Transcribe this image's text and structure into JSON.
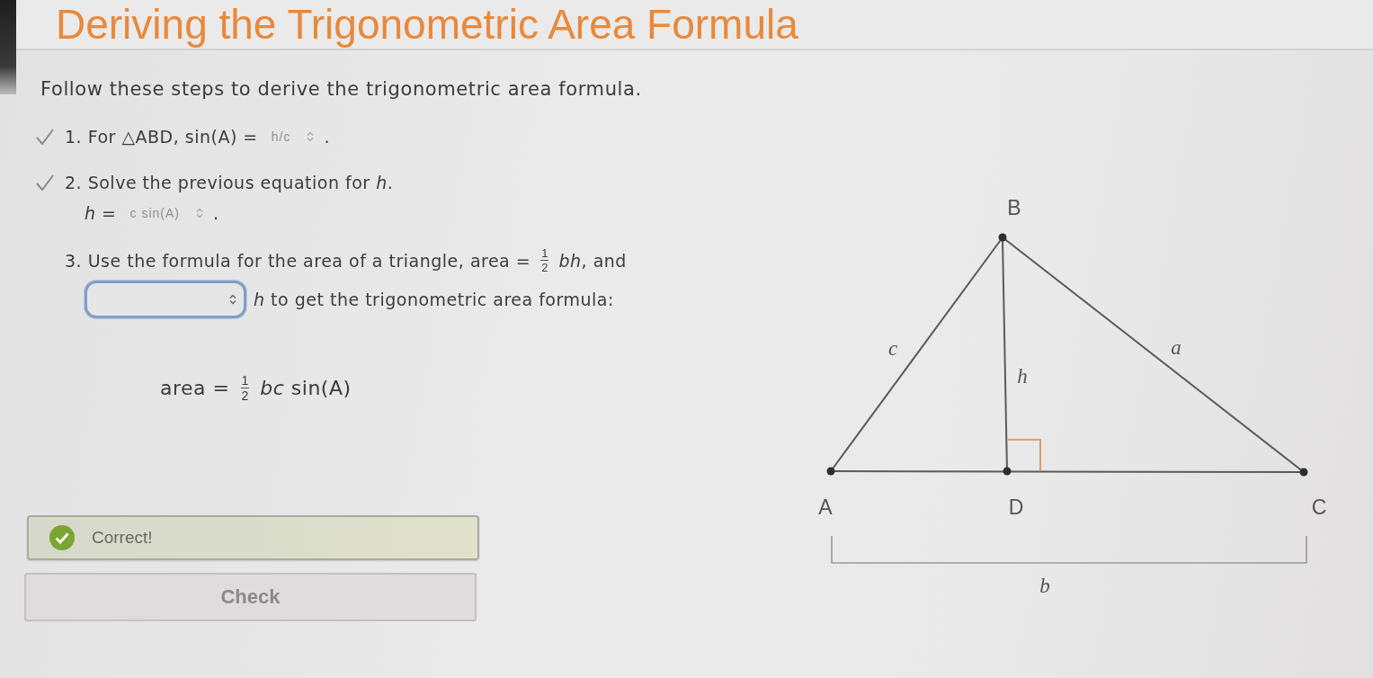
{
  "header": {
    "title": "Deriving the Trigonometric Area Formula"
  },
  "instructions": "Follow these steps to derive the trigonometric area formula.",
  "steps": [
    {
      "completed": true,
      "lines": [
        {
          "parts": [
            {
              "kind": "text",
              "text": "1. For △ABD, sin(A) ="
            },
            {
              "kind": "dropdown",
              "value": "h/c",
              "disabled": true,
              "focused": false
            },
            {
              "kind": "text",
              "text": "."
            }
          ]
        }
      ]
    },
    {
      "completed": true,
      "lines": [
        {
          "parts": [
            {
              "kind": "text",
              "text": "2. Solve the previous equation for *h*."
            }
          ]
        },
        {
          "parts": [
            {
              "kind": "text",
              "text": "*h* ="
            },
            {
              "kind": "dropdown",
              "value": "c sin(A)",
              "disabled": true,
              "focused": false
            },
            {
              "kind": "text",
              "text": "."
            }
          ]
        }
      ]
    },
    {
      "completed": false,
      "lines": [
        {
          "parts": [
            {
              "kind": "text",
              "text": "3. Use the formula for the area of a triangle, area ="
            },
            {
              "kind": "fraction",
              "numerator": "1",
              "denominator": "2"
            },
            {
              "kind": "text",
              "text": "*bh*, and"
            }
          ]
        },
        {
          "parts": [
            {
              "kind": "dropdown",
              "disabled": false,
              "focused": true
            },
            {
              "kind": "text",
              "text": "*h* to get the trigonometric area formula:"
            }
          ]
        }
      ],
      "result": {
        "parts": [
          {
            "kind": "text",
            "text": "area ="
          },
          {
            "kind": "fraction",
            "numerator": "1",
            "denominator": "2"
          },
          {
            "kind": "text",
            "text": "*bc* sin(A)"
          }
        ]
      }
    }
  ],
  "feedback": {
    "kind": "correct",
    "message": "Correct!"
  },
  "check_button": {
    "label": "Check",
    "disabled": true
  },
  "diagram": {
    "points": [
      {
        "label": "B"
      },
      {
        "label": "A"
      },
      {
        "label": "D"
      },
      {
        "label": "C"
      }
    ],
    "side_labels": [
      {
        "label": "c"
      },
      {
        "label": "a"
      }
    ],
    "altitude": {
      "label": "h",
      "right_angle": true
    },
    "base": {
      "label": "b"
    }
  }
}
